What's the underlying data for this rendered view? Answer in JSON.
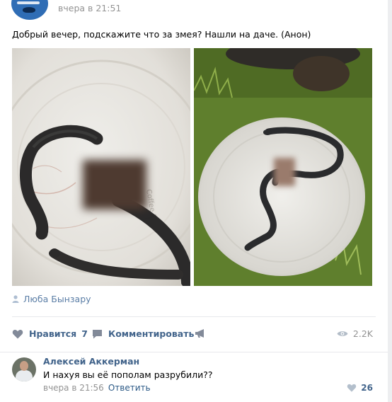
{
  "post": {
    "time": "вчера в 21:51",
    "text": "Добрый вечер, подскажите что за змея? Нашли на даче. (Анон)",
    "author": "Люба Бынзару",
    "photos": [
      "snake-photo-1",
      "snake-photo-2"
    ]
  },
  "actions": {
    "like_label": "Нравится",
    "like_count": "7",
    "comment_label": "Комментировать",
    "views": "2.2K"
  },
  "comment": {
    "author": "Алексей Аккерман",
    "text": "И нахуя вы её пополам разрубили??",
    "time": "вчера в 21:56",
    "reply_label": "Ответить",
    "likes": "26"
  },
  "icons": {
    "like": "heart-icon",
    "comment": "comment-icon",
    "share": "megaphone-icon",
    "views": "eye-icon",
    "author": "person-icon"
  },
  "colors": {
    "link": "#42648b",
    "muted": "#939393",
    "accent": "#5181b8"
  }
}
